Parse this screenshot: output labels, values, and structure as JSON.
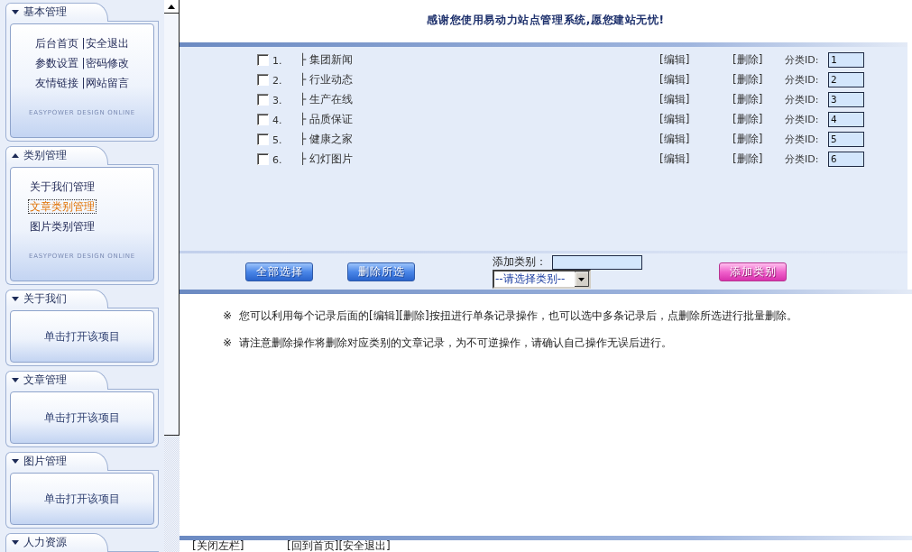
{
  "sidebar": {
    "panels": [
      {
        "title": "基本管理",
        "caret_up": false,
        "kind": "links",
        "separator": "|",
        "rows": [
          [
            "后台首页",
            "安全退出"
          ],
          [
            "参数设置",
            "密码修改"
          ],
          [
            "友情链接",
            "网站留言"
          ]
        ],
        "footer": "EASYPOWER DESIGN ONLINE"
      },
      {
        "title": "类别管理",
        "caret_up": true,
        "kind": "list",
        "items": [
          {
            "label": "关于我们管理",
            "selected": false
          },
          {
            "label": "文章类别管理",
            "selected": true
          },
          {
            "label": "图片类别管理",
            "selected": false
          }
        ],
        "footer": "EASYPOWER DESIGN ONLINE"
      },
      {
        "title": "关于我们",
        "caret_up": false,
        "kind": "collapsed",
        "hint": "单击打开该项目"
      },
      {
        "title": "文章管理",
        "caret_up": false,
        "kind": "collapsed",
        "hint": "单击打开该项目"
      },
      {
        "title": "图片管理",
        "caret_up": false,
        "kind": "collapsed",
        "hint": "单击打开该项目"
      },
      {
        "title": "人力资源",
        "caret_up": false,
        "kind": "collapsed"
      }
    ]
  },
  "header": {
    "title": "感谢您使用易动力站点管理系统,愿您建站无忧!"
  },
  "categories": {
    "rows": [
      {
        "checked": false,
        "number": "1.",
        "name": "├ 集团新闻",
        "edit": "[编辑]",
        "delete": "[删除]",
        "id_label": "分类ID:",
        "id": "1"
      },
      {
        "checked": false,
        "number": "2.",
        "name": "├ 行业动态",
        "edit": "[编辑]",
        "delete": "[删除]",
        "id_label": "分类ID:",
        "id": "2"
      },
      {
        "checked": false,
        "number": "3.",
        "name": "├ 生产在线",
        "edit": "[编辑]",
        "delete": "[删除]",
        "id_label": "分类ID:",
        "id": "3"
      },
      {
        "checked": false,
        "number": "4.",
        "name": "├ 品质保证",
        "edit": "[编辑]",
        "delete": "[删除]",
        "id_label": "分类ID:",
        "id": "4"
      },
      {
        "checked": false,
        "number": "5.",
        "name": "├ 健康之家",
        "edit": "[编辑]",
        "delete": "[删除]",
        "id_label": "分类ID:",
        "id": "5"
      },
      {
        "checked": false,
        "number": "6.",
        "name": "├ 幻灯图片",
        "edit": "[编辑]",
        "delete": "[删除]",
        "id_label": "分类ID:",
        "id": "6"
      }
    ]
  },
  "actions": {
    "buttons": [
      {
        "label": "全部选择",
        "kind": "standard"
      },
      {
        "label": "删除所选",
        "kind": "standard"
      }
    ],
    "add_label": "添加类别：",
    "select": "--请选择类别--",
    "add_button": {
      "label": "添加类别",
      "kind": "accent"
    }
  },
  "notes": [
    {
      "mark": "※",
      "text": "您可以利用每个记录后面的[编辑][删除]按扭进行单条记录操作，也可以选中多条记录后，点删除所选进行批量删除。"
    },
    {
      "mark": "※",
      "text": "请注意删除操作将删除对应类别的文章记录，为不可逆操作，请确认自己操作无误后进行。"
    }
  ],
  "footer": {
    "links": [
      "[关闭左栏]",
      "[回到首页]",
      "[安全退出]"
    ]
  }
}
